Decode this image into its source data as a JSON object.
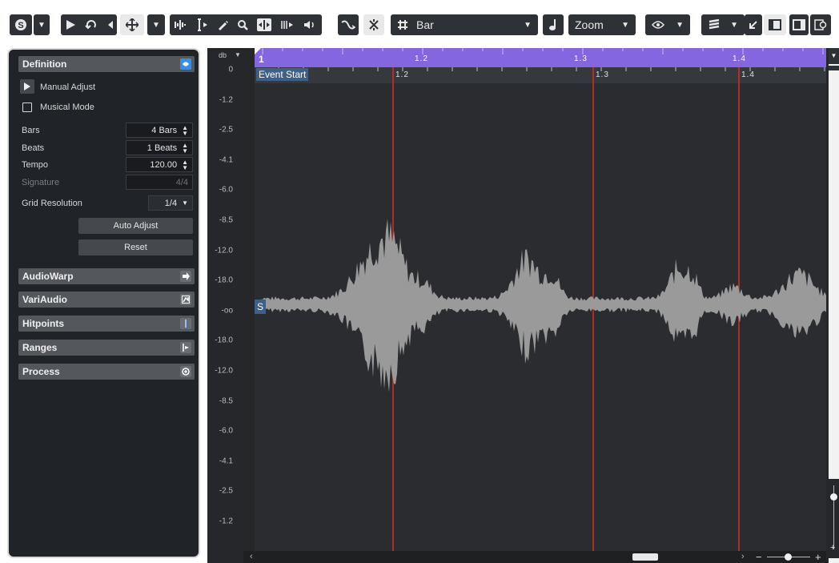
{
  "toolbar": {
    "snap_type": "Bar",
    "zoom_label": "Zoom"
  },
  "inspector": {
    "sections": {
      "definition": "Definition",
      "audiowarp": "AudioWarp",
      "variaudio": "VariAudio",
      "hitpoints": "Hitpoints",
      "ranges": "Ranges",
      "process": "Process"
    },
    "manual_adjust": "Manual Adjust",
    "musical_mode": "Musical Mode",
    "musical_mode_checked": false,
    "bars_label": "Bars",
    "bars_value": "4 Bars",
    "beats_label": "Beats",
    "beats_value": "1 Beats",
    "tempo_label": "Tempo",
    "tempo_value": "120.00",
    "signature_label": "Signature",
    "signature_value": "4/4",
    "grid_label": "Grid Resolution",
    "grid_value": "1/4",
    "auto_adjust": "Auto Adjust",
    "reset": "Reset"
  },
  "editor": {
    "db_unit": "db",
    "db_ticks": [
      "0",
      "-1.2",
      "-2.5",
      "-4.1",
      "-6.0",
      "-8.5",
      "-12.0",
      "-18.0",
      "-oo",
      "-18.0",
      "-12.0",
      "-8.5",
      "-6.0",
      "-4.1",
      "-2.5",
      "-1.2"
    ],
    "ruler_labels": [
      "1",
      "1.2",
      "1.3",
      "1.4"
    ],
    "event_labels": [
      "1.2",
      "1.3",
      "1.4"
    ],
    "event_start": "Event Start",
    "start_marker": "S"
  },
  "colors": {
    "accent_purple": "#8466e0",
    "grid_line_red": "#d92b2b",
    "panel_bg": "#202327",
    "waveform": "#9a9a9a",
    "musical_mode_icon": "#3b8fe0"
  }
}
